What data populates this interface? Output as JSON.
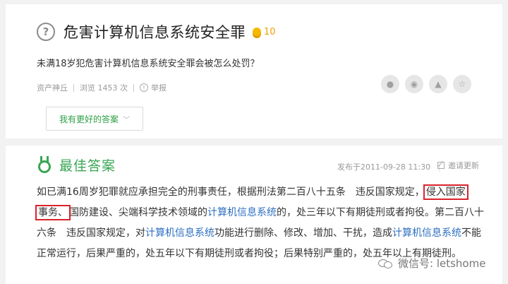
{
  "question": {
    "title": "危害计算机信息系统安全罪",
    "reward": "10",
    "description": "未满18岁犯危害计算机信息系统安全罪会被怎么处罚？",
    "author": "资产神丘",
    "views": "浏览 1453 次",
    "report": "举报",
    "better_answer_button": "我有更好的答案"
  },
  "answer": {
    "label": "最佳答案",
    "date": "发布于2011-09-28 11:30",
    "invite": "邀请更新",
    "body": {
      "p1": "如已满16周岁犯罪就应承担完全的刑事责任，根据刑法第二百八十五条　违反国家规定，",
      "hl1": "侵入国家",
      "hl2": "事务、",
      "p2": "国防建设、尖端科学技术领域的",
      "link1": "计算机信息系统",
      "p3": "的，处三年以下有期徒刑或者拘役。第二百八十六条　违反国家规定，对",
      "link2": "计算机信息系统",
      "p4": "功能进行删除、修改、增加、干扰，造成",
      "link3": "计算机信息系统",
      "p5": "不能正常运行，后果严重的，处五年以下有期徒刑或者拘役；后果特别严重的，处五年以上有期徒刑。"
    }
  },
  "watermark": "微信号: letshome",
  "icons": [
    "question-icon",
    "coin-icon",
    "report-icon",
    "wechat-share-icon",
    "weibo-share-icon",
    "qq-share-icon",
    "star-icon",
    "medal-icon",
    "edit-icon",
    "chevron-down-icon",
    "wechat-logo-icon"
  ]
}
